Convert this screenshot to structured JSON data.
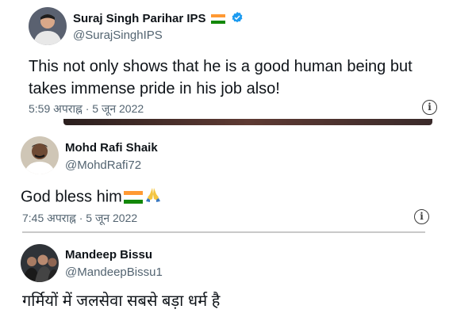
{
  "tweets": [
    {
      "name": "Suraj Singh Parihar IPS",
      "handle": "@SurajSinghIPS",
      "text": "This not only shows that he is a good human being but takes immense pride in his job also!",
      "timestamp": "5:59 अपराह्न · 5 जून 2022",
      "verified": true,
      "icons": [
        "india-flag-icon",
        "verified-badge-icon",
        "info-icon"
      ]
    },
    {
      "name": "Mohd Rafi Shaik",
      "handle": "@MohdRafi72",
      "text": "God bless him",
      "timestamp": "7:45 अपराह्न · 5 जून 2022",
      "icons": [
        "india-flag-icon",
        "folded-hands-icon",
        "info-icon"
      ]
    },
    {
      "name": "Mandeep Bissu",
      "handle": "@MandeepBissu1",
      "text": "गर्मियों में जलसेवा सबसे बड़ा धर्म है"
    }
  ],
  "colors": {
    "verified": "#1d9bf0",
    "secondary_text": "#536471",
    "primary_text": "#0f1419"
  }
}
